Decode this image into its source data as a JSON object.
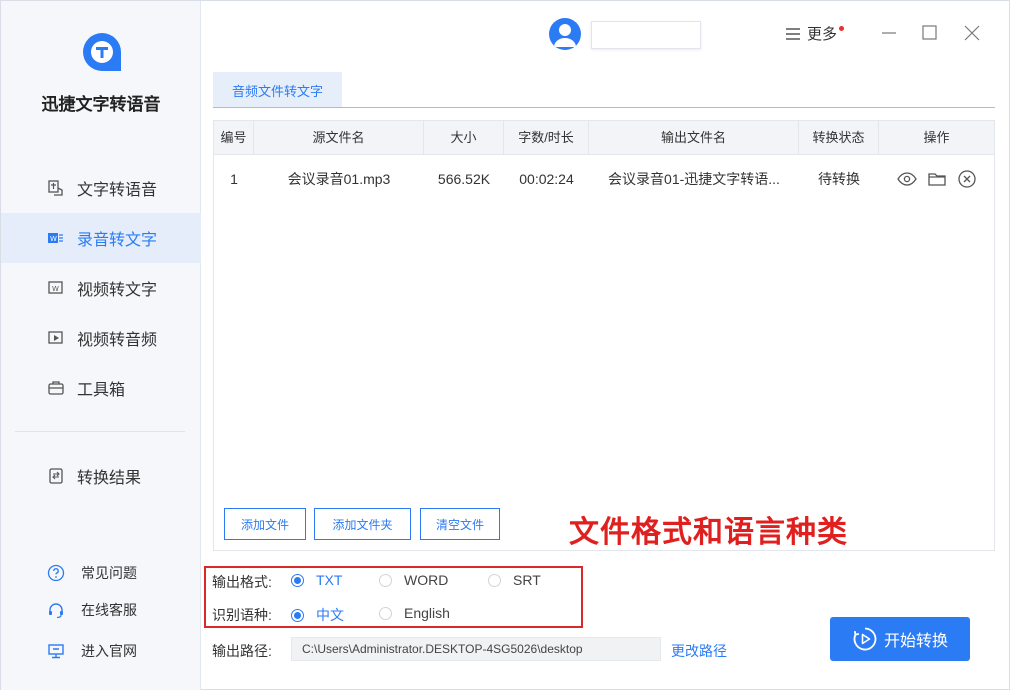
{
  "app": {
    "name": "迅捷文字转语音"
  },
  "sidebar": {
    "items": [
      {
        "label": "文字转语音",
        "icon": "text-to-speech-icon"
      },
      {
        "label": "录音转文字",
        "icon": "audio-word-icon",
        "active": true
      },
      {
        "label": "视频转文字",
        "icon": "video-word-icon"
      },
      {
        "label": "视频转音频",
        "icon": "video-audio-icon"
      },
      {
        "label": "工具箱",
        "icon": "toolbox-icon"
      },
      {
        "label": "转换结果",
        "icon": "result-icon"
      }
    ],
    "help": [
      {
        "label": "常见问题",
        "icon": "question-icon"
      },
      {
        "label": "在线客服",
        "icon": "headset-icon"
      },
      {
        "label": "进入官网",
        "icon": "monitor-icon"
      }
    ]
  },
  "header": {
    "more_label": "更多"
  },
  "tab": {
    "label": "音频文件转文字"
  },
  "table": {
    "headers": [
      "编号",
      "源文件名",
      "大小",
      "字数/时长",
      "输出文件名",
      "转换状态",
      "操作"
    ],
    "rows": [
      {
        "index": "1",
        "source": "会议录音01.mp3",
        "size": "566.52K",
        "duration": "00:02:24",
        "output": "会议录音01-迅捷文字转语...",
        "status": "待转换"
      }
    ]
  },
  "buttons": {
    "add_file": "添加文件",
    "add_folder": "添加文件夹",
    "clear": "清空文件",
    "start": "开始转换",
    "change_path": "更改路径"
  },
  "annotation": "文件格式和语言种类",
  "settings": {
    "format_label": "输出格式:",
    "formats": [
      "TXT",
      "WORD",
      "SRT"
    ],
    "language_label": "识别语种:",
    "languages": [
      "中文",
      "English"
    ],
    "path_label": "输出路径:",
    "path_value": "C:\\Users\\Administrator.DESKTOP-4SG5026\\desktop"
  },
  "colors": {
    "accent": "#2b7bf5",
    "annotation": "#e01f1f"
  }
}
